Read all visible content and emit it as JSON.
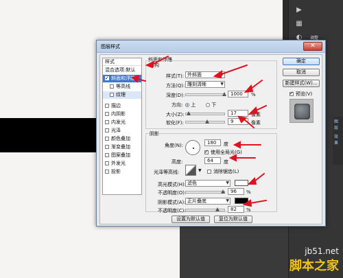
{
  "dialog": {
    "title": "图层样式",
    "close_label": "✕"
  },
  "style_list": {
    "header": "样式",
    "blend_defaults": "混合选项:默认",
    "items": [
      {
        "label": "斜面和浮雕",
        "checked": true,
        "selected": true
      },
      {
        "label": "等高线",
        "checked": false,
        "sub": true
      },
      {
        "label": "纹理",
        "checked": false,
        "sub": true
      },
      {
        "label": "描边",
        "checked": false
      },
      {
        "label": "内阴影",
        "checked": false
      },
      {
        "label": "内发光",
        "checked": false
      },
      {
        "label": "光泽",
        "checked": false
      },
      {
        "label": "颜色叠加",
        "checked": false
      },
      {
        "label": "渐变叠加",
        "checked": false
      },
      {
        "label": "图案叠加",
        "checked": false
      },
      {
        "label": "外发光",
        "checked": false
      },
      {
        "label": "投影",
        "checked": false
      }
    ]
  },
  "bevel": {
    "group_title": "斜面和浮雕",
    "structure_title": "结构",
    "style_label": "样式(T):",
    "style_value": "外斜面",
    "technique_label": "方法(Q):",
    "technique_value": "雕刻清晰",
    "depth_label": "深度(D):",
    "depth_value": "1000",
    "depth_unit": "%",
    "depth_level": 1.0,
    "direction_label": "方向:",
    "direction_up": "上",
    "direction_down": "下",
    "size_label": "大小(Z):",
    "size_value": "17",
    "size_unit": "像素",
    "size_level": 0.07,
    "soften_label": "软化(F):",
    "soften_value": "9",
    "soften_unit": "像素",
    "soften_level": 0.55
  },
  "shading": {
    "title": "阴影",
    "angle_label": "角度(N):",
    "angle_value": "180",
    "angle_unit": "度",
    "global_light_label": "使用全局光(G)",
    "altitude_label": "高度:",
    "altitude_value": "64",
    "altitude_unit": "度",
    "gloss_label": "光泽等高线:",
    "antialias_label": "消除锯齿(L)",
    "highlight_mode_label": "高光模式(H):",
    "highlight_mode_value": "滤色",
    "highlight_color": "#ffffff",
    "highlight_opacity_label": "不透明度(O):",
    "highlight_opacity_value": "96",
    "highlight_opacity_level": 0.96,
    "shadow_mode_label": "阴影模式(A):",
    "shadow_mode_value": "正片叠底",
    "shadow_color": "#000000",
    "shadow_opacity_label": "不透明度(C):",
    "shadow_opacity_value": "82",
    "shadow_opacity_level": 0.82,
    "percent": "%"
  },
  "footer": {
    "make_default": "设置为默认值",
    "reset_default": "复位为默认值"
  },
  "buttons": {
    "ok": "确定",
    "cancel": "取消",
    "new_style": "新建样式(W)...",
    "preview": "预览(V)"
  },
  "ps_panel": {
    "label1": "调整",
    "label2": "图层",
    "label3": "图层",
    "label4": "效果"
  },
  "watermark": {
    "site": "jb51.net",
    "brand": "脚本之家"
  },
  "colors": {
    "selected": "#3a79d3",
    "annotation": "#e0121f"
  }
}
